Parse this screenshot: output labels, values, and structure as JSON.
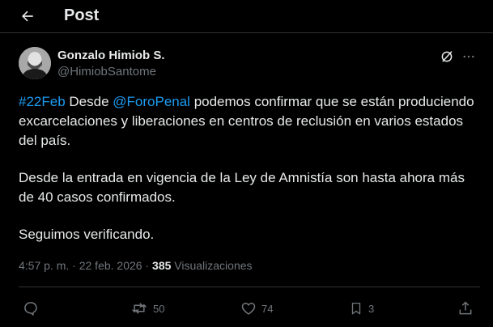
{
  "header": {
    "title": "Post"
  },
  "post": {
    "author": {
      "name": "Gonzalo Himiob S.",
      "handle": "@HimiobSantome"
    },
    "paragraphs": {
      "p1_hashtag": "#22Feb",
      "p1_text1": " Desde ",
      "p1_mention": "@ForoPenal",
      "p1_text2": " podemos confirmar que se están produciendo excarcelaciones y liberaciones en centros de reclusión en varios estados del país.",
      "p2": "Desde la entrada en vigencia de la Ley de Amnistía son hasta ahora más de 40 casos confirmados.",
      "p3": "Seguimos verificando."
    },
    "meta": {
      "time": "4:57 p. m.",
      "separator": " · ",
      "date": "22 feb. 2026",
      "views_count": "385",
      "views_label": " Visualizaciones"
    }
  },
  "actions": {
    "reposts": "50",
    "likes": "74",
    "bookmarks": "3"
  },
  "colors": {
    "accent": "#1d9bf0",
    "muted": "#71767b",
    "text": "#e7e9ea",
    "background": "#000000",
    "border": "#2f3336"
  }
}
